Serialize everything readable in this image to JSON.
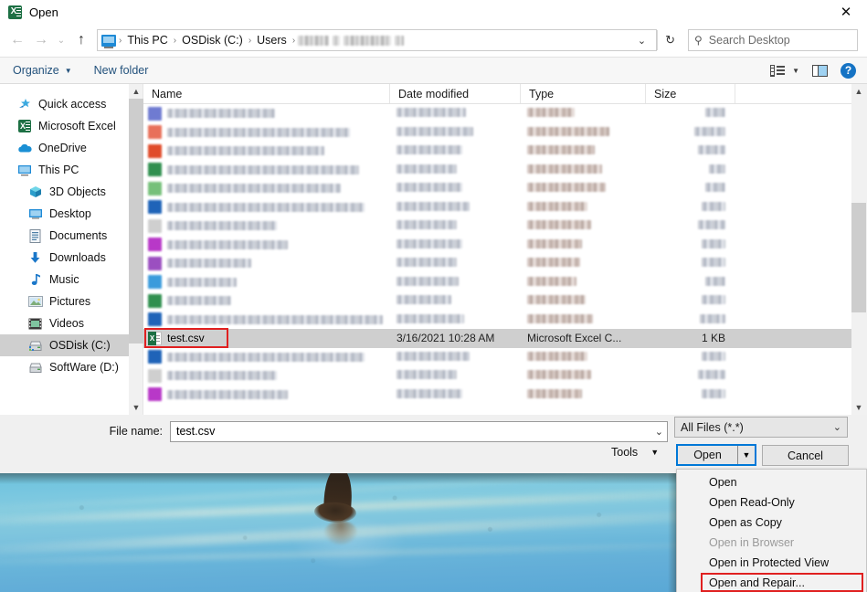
{
  "window": {
    "title": "Open",
    "app_icon": "excel-icon",
    "close_label": "✕"
  },
  "nav": {
    "back_icon": "←",
    "forward_icon": "→",
    "recent_icon": "⌄",
    "up_icon": "↑",
    "refresh_icon": "↻",
    "dropdown_icon": "⌄"
  },
  "breadcrumb": {
    "items": [
      "This PC",
      "OSDisk (C:)",
      "Users"
    ],
    "separator": "›",
    "redacted_segments": 3
  },
  "search": {
    "placeholder": "Search Desktop",
    "icon": "search-icon"
  },
  "command_bar": {
    "organize_label": "Organize",
    "new_folder_label": "New folder",
    "caret": "▼",
    "view_icon": "list-view-icon",
    "view_caret": "▼",
    "pane_icon": "preview-pane-icon",
    "help_icon": "?"
  },
  "sidebar": {
    "items": [
      {
        "label": "Quick access",
        "icon": "star-icon",
        "indent": false,
        "selected": false
      },
      {
        "label": "Microsoft Excel",
        "icon": "excel-icon",
        "indent": false,
        "selected": false
      },
      {
        "label": "OneDrive",
        "icon": "cloud-icon",
        "indent": false,
        "selected": false
      },
      {
        "label": "This PC",
        "icon": "monitor-icon",
        "indent": false,
        "selected": false
      },
      {
        "label": "3D Objects",
        "icon": "cube-icon",
        "indent": true,
        "selected": false
      },
      {
        "label": "Desktop",
        "icon": "desktop-icon",
        "indent": true,
        "selected": false
      },
      {
        "label": "Documents",
        "icon": "document-icon",
        "indent": true,
        "selected": false
      },
      {
        "label": "Downloads",
        "icon": "download-arrow-icon",
        "indent": true,
        "selected": false
      },
      {
        "label": "Music",
        "icon": "music-note-icon",
        "indent": true,
        "selected": false
      },
      {
        "label": "Pictures",
        "icon": "picture-icon",
        "indent": true,
        "selected": false
      },
      {
        "label": "Videos",
        "icon": "video-icon",
        "indent": true,
        "selected": false
      },
      {
        "label": "OSDisk (C:)",
        "icon": "drive-icon",
        "indent": true,
        "selected": true
      },
      {
        "label": "SoftWare (D:)",
        "icon": "drive-icon",
        "indent": true,
        "selected": false
      }
    ]
  },
  "file_list": {
    "columns": [
      {
        "label": "Name",
        "sorted": true
      },
      {
        "label": "Date modified",
        "sorted": false
      },
      {
        "label": "Type",
        "sorted": false
      },
      {
        "label": "Size",
        "sorted": false
      }
    ],
    "selected_row": {
      "name": "test.csv",
      "date_modified": "3/16/2021 10:28 AM",
      "type": "Microsoft Excel C...",
      "size": "1 KB",
      "icon": "csv-file-icon",
      "highlighted": true
    },
    "redacted_rows_above": 12,
    "redacted_rows_below": 3,
    "redaction_note": "file names, dates, types and sizes are blurred/redacted"
  },
  "footer": {
    "file_name_label": "File name:",
    "file_name_value": "test.csv",
    "file_name_caret": "⌄",
    "filter_value": "All Files (*.*)",
    "filter_caret": "⌄",
    "tools_label": "Tools",
    "tools_caret": "▼",
    "open_label": "Open",
    "open_caret": "▼",
    "cancel_label": "Cancel"
  },
  "open_menu": {
    "items": [
      {
        "label": "Open",
        "disabled": false,
        "highlighted": false
      },
      {
        "label": "Open Read-Only",
        "disabled": false,
        "highlighted": false
      },
      {
        "label": "Open as Copy",
        "disabled": false,
        "highlighted": false
      },
      {
        "label": "Open in Browser",
        "disabled": true,
        "highlighted": false
      },
      {
        "label": "Open in Protected View",
        "disabled": false,
        "highlighted": false
      },
      {
        "label": "Open and Repair...",
        "disabled": false,
        "highlighted": true
      }
    ]
  },
  "colors": {
    "accent": "#0078d7",
    "highlight_box": "#e02020",
    "selection": "#cfcfcf",
    "excel_green": "#1d7044",
    "link_blue": "#23527c"
  },
  "background_photo": {
    "description": "blue ice / water surface with dark figure silhouette and reflection"
  }
}
